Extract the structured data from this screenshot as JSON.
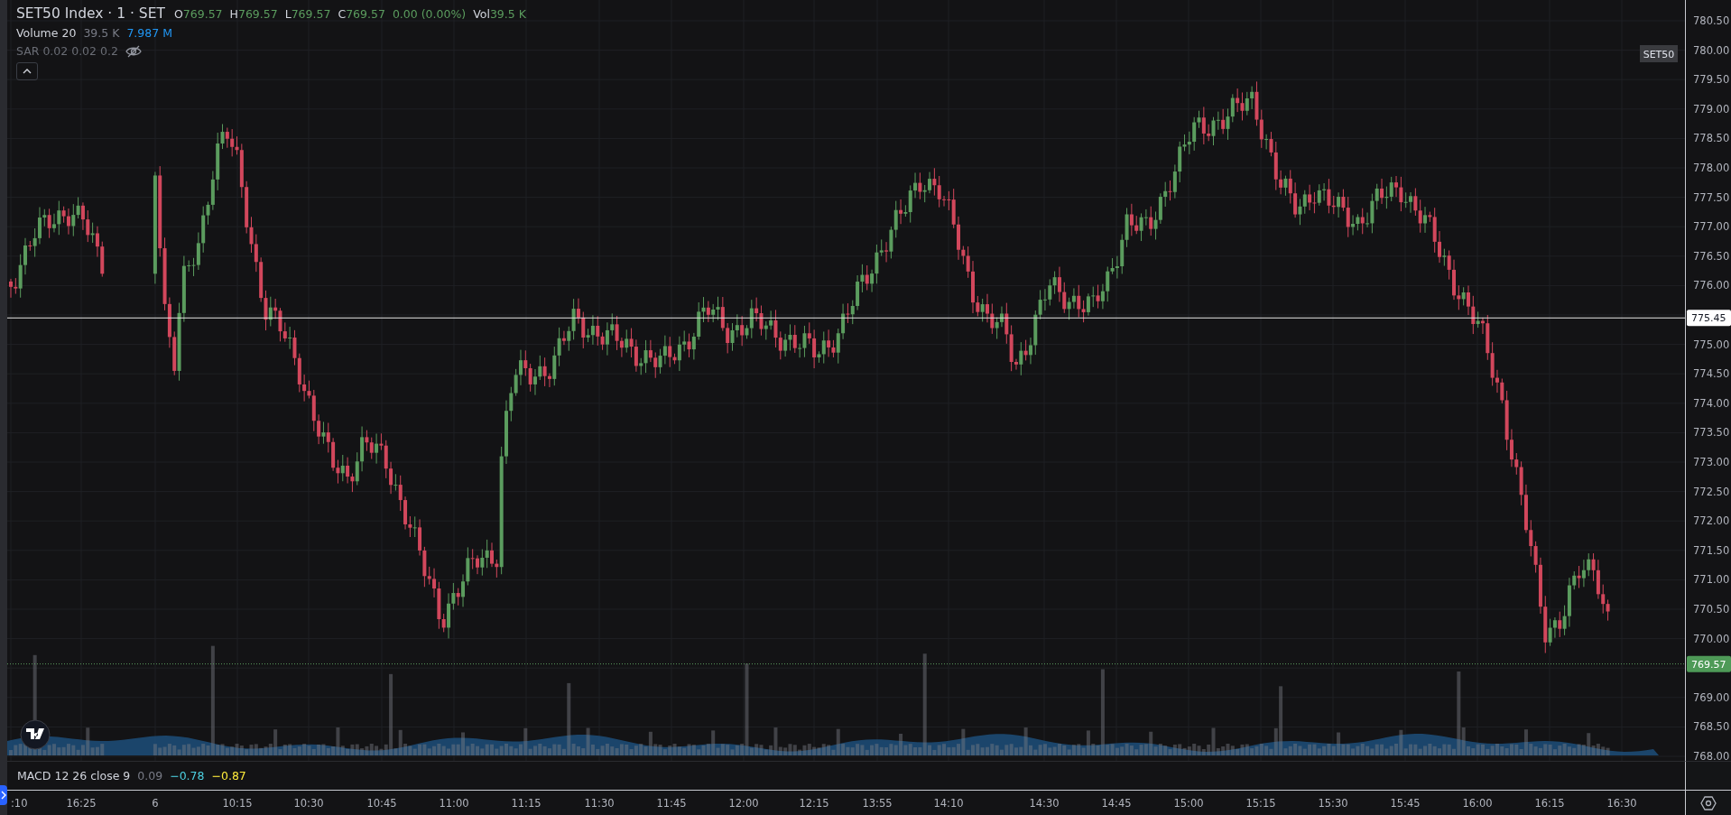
{
  "legend": {
    "symbol": "SET50 Index · 1 · SET",
    "ohlc": [
      {
        "label": "O",
        "value": "769.57"
      },
      {
        "label": "H",
        "value": "769.57"
      },
      {
        "label": "L",
        "value": "769.57"
      },
      {
        "label": "C",
        "value": "769.57"
      }
    ],
    "change": "0.00 (0.00%)",
    "volume": {
      "label": "Vol",
      "value": "39.5 K"
    }
  },
  "indicators": [
    {
      "name": "Volume 20",
      "hidden": false,
      "values": [
        {
          "text": "39.5 K",
          "color": "#787b86"
        },
        {
          "text": "7.987 M",
          "color": "#2196f3"
        }
      ]
    },
    {
      "name": "SAR 0.02 0.02 0.2",
      "hidden": true
    }
  ],
  "price_axis": {
    "ticks": [
      "780.50",
      "780.00",
      "779.50",
      "779.00",
      "778.50",
      "778.00",
      "777.50",
      "777.00",
      "776.50",
      "776.00",
      "775.00",
      "774.50",
      "774.00",
      "773.50",
      "773.00",
      "772.50",
      "772.00",
      "771.50",
      "771.00",
      "770.50",
      "770.00",
      "769.00",
      "768.50",
      "768.00"
    ]
  },
  "badges": [
    {
      "kind": "symbol",
      "text": "SET50"
    },
    {
      "kind": "crosshair",
      "text": "775.45"
    },
    {
      "kind": "last",
      "text": "769.57"
    }
  ],
  "macd": {
    "name": "MACD 12 26 close 9",
    "values": [
      {
        "text": "0.09",
        "color": "#787b86"
      },
      {
        "text": "−0.78",
        "color": "#4dd0e1"
      },
      {
        "text": "−0.87",
        "color": "#ffeb3b"
      }
    ]
  },
  "time_axis": {
    "labels": [
      ":10",
      "16:25",
      "6",
      "10:15",
      "10:30",
      "10:45",
      "11:00",
      "11:15",
      "11:30",
      "11:45",
      "12:00",
      "12:15",
      "13:55",
      "14:10",
      "14:30",
      "14:45",
      "15:00",
      "15:15",
      "15:30",
      "15:45",
      "16:00",
      "16:15",
      "16:30"
    ]
  }
}
